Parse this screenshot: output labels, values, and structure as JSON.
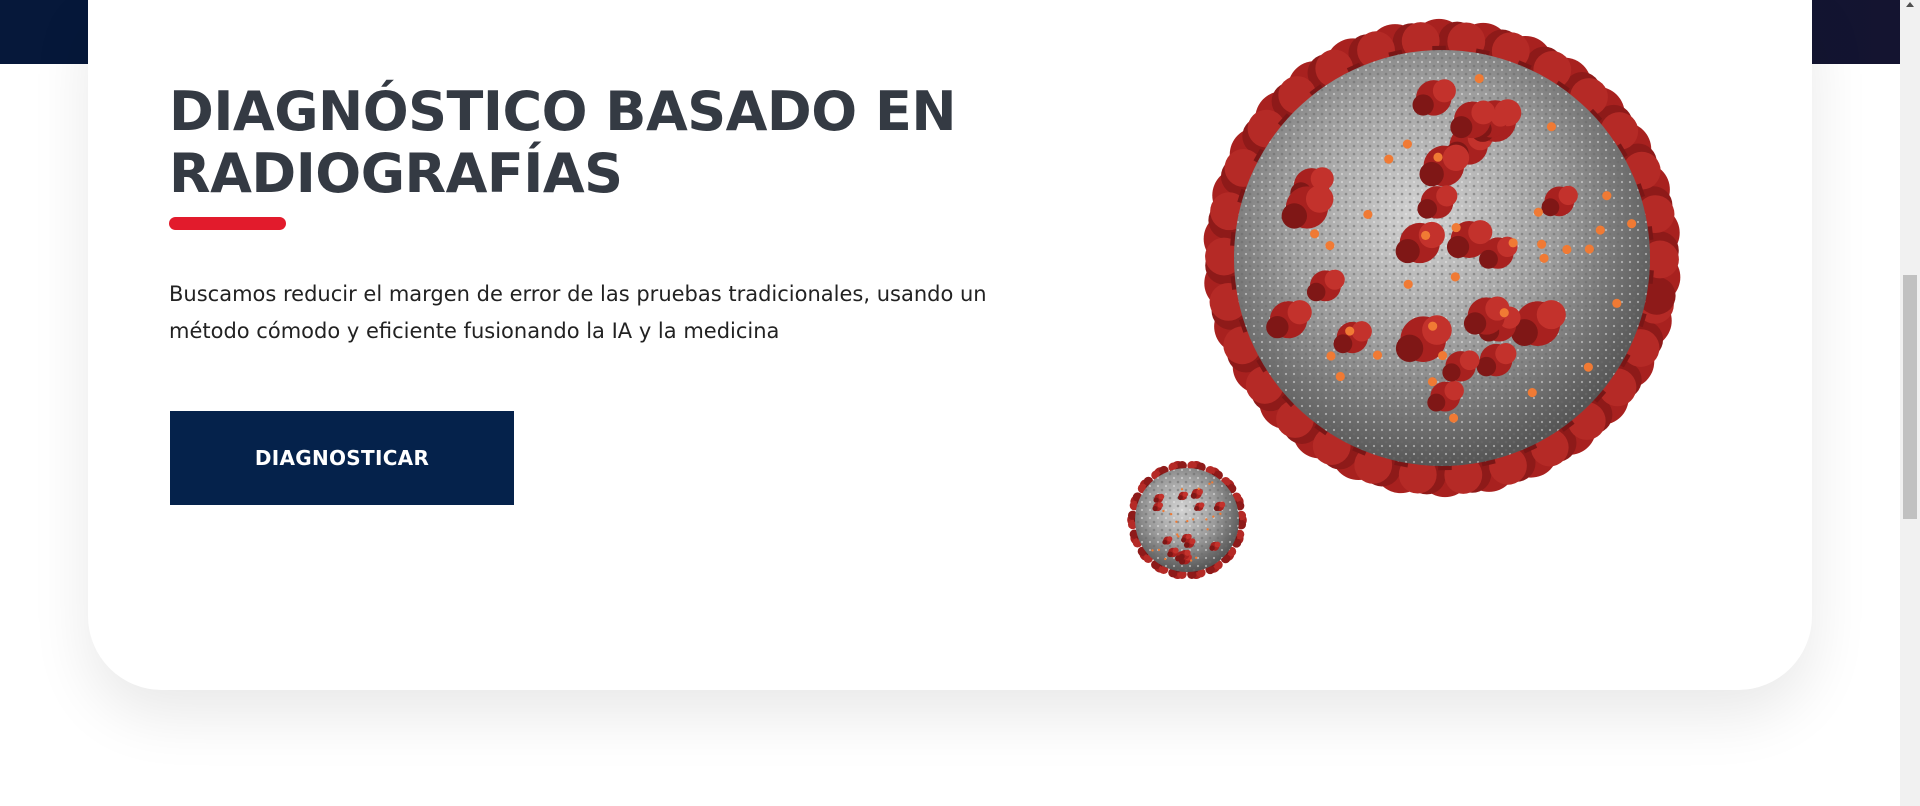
{
  "hero": {
    "heading_lines": [
      "DIAGNÓSTICO BASADO EN",
      "RADIOGRAFÍAS"
    ],
    "description": "Buscamos reducir el margen de error de las pruebas tradicionales, usando un método cómodo y eficiente fusionando la IA y la medicina",
    "cta_label": "DIAGNOSTICAR",
    "illustration": "coronavirus-image"
  },
  "colors": {
    "nav_band": "#06183a",
    "heading": "#343a43",
    "accent": "#e21b2c",
    "button": "#05224b",
    "button_text": "#ffffff",
    "virus_body": "#9a9a9a",
    "virus_spike": "#a8211f",
    "virus_dot": "#f07a34"
  }
}
